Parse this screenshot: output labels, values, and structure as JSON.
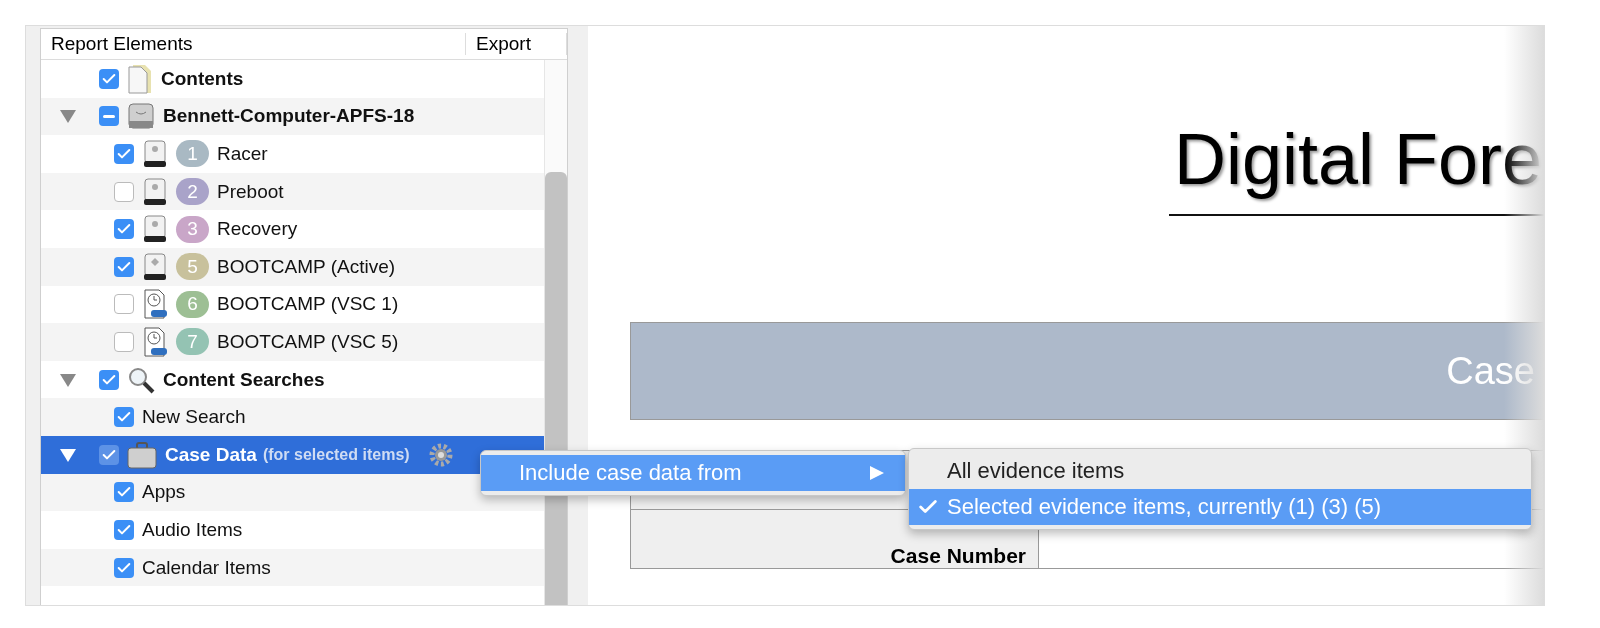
{
  "panel": {
    "columns": [
      "Report Elements",
      "Export"
    ],
    "items": [
      {
        "label": "Contents",
        "kind": "document",
        "checked": true,
        "selected": false
      },
      {
        "label": "Bennett-Computer-APFS-18",
        "kind": "disk",
        "mixed": true,
        "expanded": true,
        "selected": false,
        "children": [
          {
            "label": "Racer",
            "kind": "volume",
            "badge": "1",
            "color": "#a9b9c3",
            "checked": true,
            "selected": false
          },
          {
            "label": "Preboot",
            "kind": "volume",
            "badge": "2",
            "color": "#a9a3c9",
            "checked": false,
            "selected": false
          },
          {
            "label": "Recovery",
            "kind": "volume",
            "badge": "3",
            "color": "#c9a6c8",
            "checked": true,
            "selected": false
          },
          {
            "label": "BOOTCAMP (Active)",
            "kind": "windows",
            "badge": "5",
            "color": "#c8c19c",
            "checked": true,
            "selected": false
          },
          {
            "label": "BOOTCAMP (VSC 1)",
            "kind": "snapshot",
            "badge": "6",
            "color": "#9dbf94",
            "checked": false,
            "selected": false
          },
          {
            "label": "BOOTCAMP (VSC 5)",
            "kind": "snapshot",
            "badge": "7",
            "color": "#94c3b3",
            "checked": false,
            "selected": false
          }
        ]
      },
      {
        "label": "Content Searches",
        "kind": "search",
        "checked": true,
        "expanded": true,
        "selected": false,
        "children": [
          {
            "label": "New Search",
            "kind": "plain",
            "checked": true,
            "selected": false
          }
        ]
      },
      {
        "label": "Case Data",
        "note": "(for selected items)",
        "kind": "case",
        "checked": true,
        "expanded": true,
        "selected": true,
        "gear": true,
        "children": [
          {
            "label": "Apps",
            "kind": "plain",
            "checked": true,
            "selected": false
          },
          {
            "label": "Audio Items",
            "kind": "plain",
            "checked": true,
            "selected": false
          },
          {
            "label": "Calendar Items",
            "kind": "plain",
            "checked": true,
            "selected": false
          }
        ]
      }
    ]
  },
  "preview": {
    "title": "Digital Fore",
    "banner": "Case",
    "rows": [
      {
        "label": "",
        "value": ""
      },
      {
        "label": "Case Number",
        "value": ""
      }
    ]
  },
  "menu": {
    "items": [
      {
        "label": "Include case data from",
        "selected": true,
        "submenu": true
      }
    ],
    "submenu": [
      {
        "label": "All evidence items",
        "selected": false
      },
      {
        "label": "Selected evidence items, currently (1) (3) (5)",
        "selected": true
      }
    ]
  }
}
